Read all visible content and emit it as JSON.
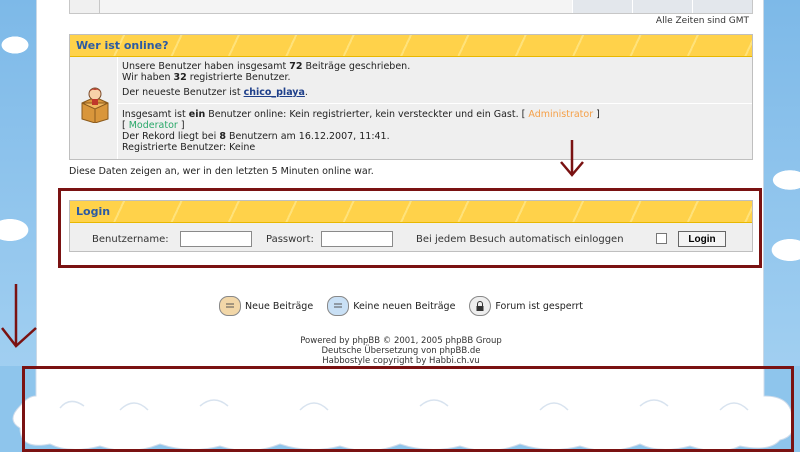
{
  "timezone_note": "Alle Zeiten sind GMT",
  "online": {
    "title": "Wer ist online?",
    "stats_line1_pre": "Unsere Benutzer haben insgesamt ",
    "stats_posts": "72",
    "stats_line1_post": " Beiträge geschrieben.",
    "stats_line2_pre": "Wir haben ",
    "stats_users": "32",
    "stats_line2_post": " registrierte Benutzer.",
    "newest_pre": "Der neueste Benutzer ist ",
    "newest_user": "chico_playa",
    "newest_post": ".",
    "users_pre": "Insgesamt ist ",
    "users_count_word": "ein",
    "users_post": " Benutzer online: Kein registrierter, kein versteckter und ein Gast.   [ ",
    "admin_label": "Administrator",
    "bracket_close": " ]",
    "bracket_open": "[ ",
    "mod_label": "Moderator",
    "record_pre": "Der Rekord liegt bei ",
    "record_count": "8",
    "record_post": " Benutzern am 16.12.2007, 11:41.",
    "registered_line": "Registrierte Benutzer: Keine",
    "note": "Diese Daten zeigen an, wer in den letzten 5 Minuten online war."
  },
  "login": {
    "title": "Login",
    "username_label": "Benutzername:",
    "username_value": "",
    "password_label": "Passwort:",
    "password_value": "",
    "autologin_label": "Bei jedem Besuch automatisch einloggen",
    "button_label": "Login"
  },
  "legend": {
    "new_posts": "Neue Beiträge",
    "no_new_posts": "Keine neuen Beiträge",
    "locked": "Forum ist gesperrt"
  },
  "footer": {
    "powered": "Powered by phpBB © 2001, 2005 phpBB Group",
    "translation": "Deutsche Übersetzung von phpBB.de",
    "style": "Habbostyle copyright by Habbi.ch.vu"
  },
  "colors": {
    "accent_yellow": "#ffd24a",
    "title_blue": "#2b5aa3",
    "annotation_red": "#7a1212",
    "admin_orange": "#f5a048",
    "moderator_green": "#2aa86a"
  }
}
